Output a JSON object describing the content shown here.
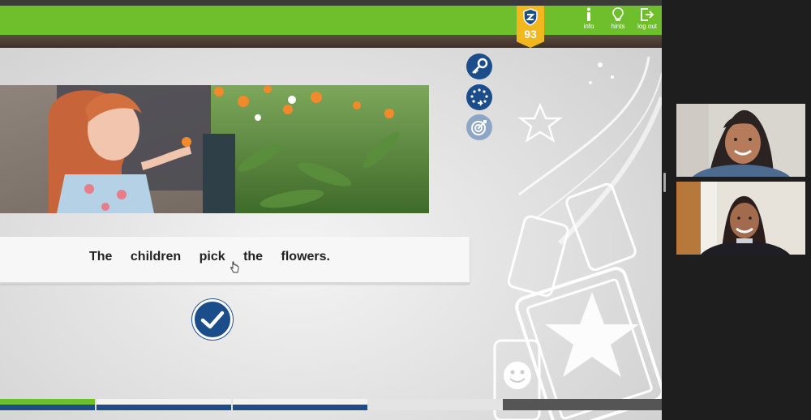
{
  "header": {
    "badge_number": "93",
    "nav": [
      {
        "label": "info",
        "icon": "info-icon"
      },
      {
        "label": "hints",
        "icon": "lightbulb-icon"
      },
      {
        "label": "log out",
        "icon": "log-out-icon"
      }
    ]
  },
  "sentence": {
    "words": [
      "The",
      "children",
      "pick",
      "the",
      "flowers."
    ]
  },
  "tools": [
    {
      "icon": "key-icon"
    },
    {
      "icon": "rotate-dots-icon"
    },
    {
      "icon": "target-icon"
    }
  ],
  "progress": {
    "segments": [
      {
        "state": "complete",
        "color": "#6fbf2c"
      },
      {
        "state": "pending",
        "color": "#1b4d8b"
      },
      {
        "state": "pending",
        "color": "#1b4d8b"
      },
      {
        "state": "pending",
        "color": "#e0e0e0"
      },
      {
        "state": "pending",
        "color": "#555555"
      }
    ]
  },
  "colors": {
    "header_green": "#6fbf2c",
    "badge_gold": "#f2b71c",
    "button_blue": "#1b4d8b"
  }
}
